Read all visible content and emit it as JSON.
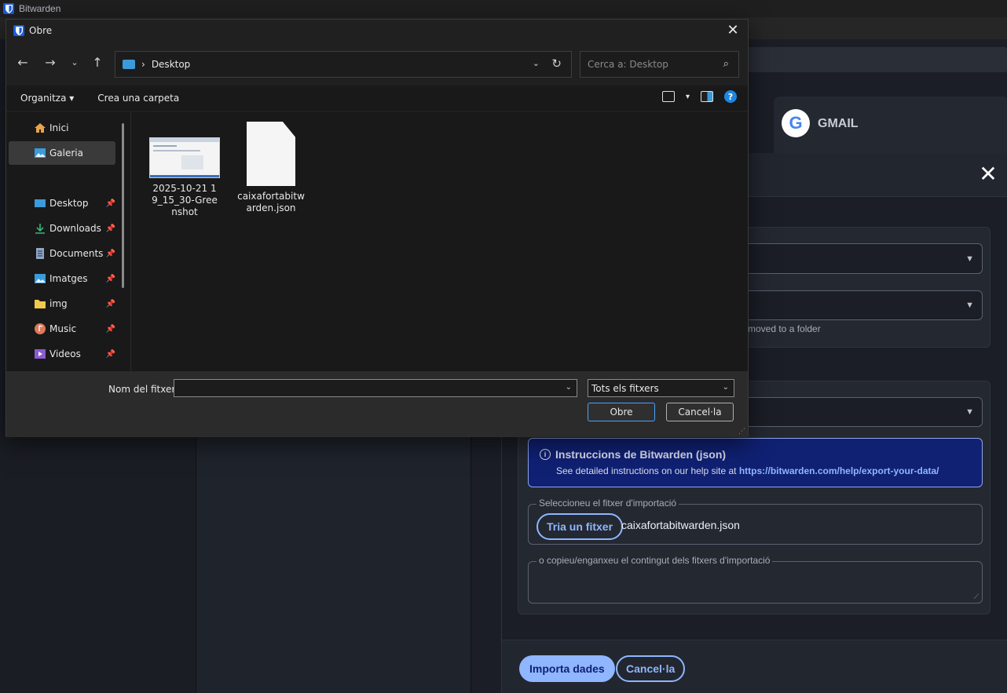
{
  "app": {
    "title": "Bitwarden"
  },
  "gmail_card": {
    "name": "GMAIL"
  },
  "import": {
    "folder_hint": "moved to a folder",
    "info_title": "Instruccions de Bitwarden (json)",
    "info_text": "See detailed instructions on our help site at",
    "info_link": "https://bitwarden.com/help/export-your-data/",
    "file_legend": "Seleccioneu el fitxer d'importació",
    "choose_file_label": "Tria un fitxer",
    "chosen_file": "caixafortabitwarden.json",
    "paste_legend": "o copieu/enganxeu el contingut dels fitxers d'importació",
    "import_button": "Importa dades",
    "cancel_button": "Cancel·la",
    "close_icon": "close-icon"
  },
  "file_dialog": {
    "title": "Obre",
    "address": "Desktop",
    "search_placeholder": "Cerca a: Desktop",
    "organize_label": "Organitza",
    "new_folder_label": "Crea una carpeta",
    "sidebar": [
      {
        "label": "Inici",
        "icon": "home-icon",
        "pinned": false
      },
      {
        "label": "Galeria",
        "icon": "gallery-icon",
        "pinned": false,
        "selected": true
      },
      {
        "label": "Desktop",
        "icon": "desktop-icon",
        "pinned": true
      },
      {
        "label": "Downloads",
        "icon": "download-icon",
        "pinned": true
      },
      {
        "label": "Documents",
        "icon": "documents-icon",
        "pinned": true
      },
      {
        "label": "Imatges",
        "icon": "pictures-icon",
        "pinned": true
      },
      {
        "label": "img",
        "icon": "folder-icon",
        "pinned": true
      },
      {
        "label": "Music",
        "icon": "music-icon",
        "pinned": true
      },
      {
        "label": "Videos",
        "icon": "videos-icon",
        "pinned": true
      }
    ],
    "files": [
      {
        "name": "2025-10-21 19_15_30-Greenshot",
        "type": "image"
      },
      {
        "name": "caixafortabitwarden.json",
        "type": "json"
      }
    ],
    "filename_label": "Nom del fitxer:",
    "filename_value": "",
    "filetype_value": "Tots els fitxers",
    "open_button": "Obre",
    "cancel_button": "Cancel·la"
  },
  "colors": {
    "bitwarden_blue": "#175ddc",
    "accent": "#8fb6ff",
    "info_bg": "#102073"
  }
}
